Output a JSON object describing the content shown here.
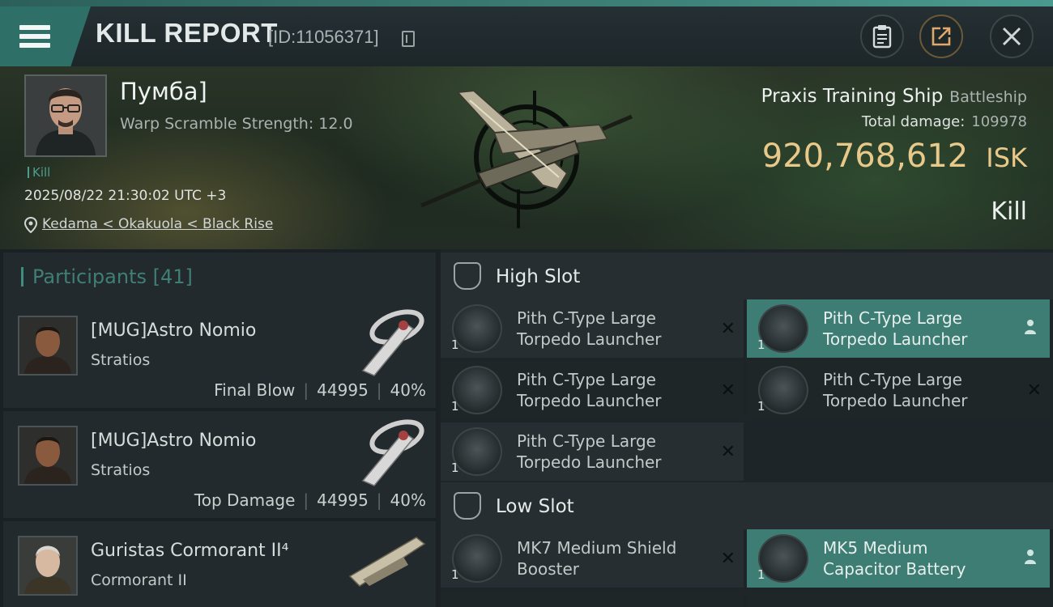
{
  "header": {
    "title": "KILL REPORT",
    "kill_id": "[ID:11056371]"
  },
  "victim": {
    "name": "Пумба]",
    "warp_scramble": "Warp Scramble Strength: 12.0",
    "tag": "Kill",
    "datetime": "2025/08/22 21:30:02 UTC +3",
    "location": "Kedama < Okakuola < Black Rise"
  },
  "ship": {
    "name": "Praxis Training Ship",
    "class": "Battleship",
    "total_damage_label": "Total damage:",
    "total_damage": "109978",
    "isk_value": "920,768,612",
    "isk_unit": "ISK",
    "result": "Kill"
  },
  "participants": {
    "label": "Participants",
    "count": "[41]",
    "items": [
      {
        "name": "[MUG]Astro Nomio",
        "ship": "Stratios",
        "tag": "Final Blow",
        "damage": "44995",
        "percent": "40%"
      },
      {
        "name": "[MUG]Astro Nomio",
        "ship": "Stratios",
        "tag": "Top Damage",
        "damage": "44995",
        "percent": "40%"
      },
      {
        "name": "Guristas Cormorant II⁴",
        "ship": "Cormorant II"
      }
    ]
  },
  "high_slot": {
    "label": "High Slot",
    "modules": [
      {
        "qty": "1",
        "line1": "Pith C-Type Large",
        "line2": "Torpedo Launcher",
        "status": "destroyed"
      },
      {
        "qty": "1",
        "line1": "Pith C-Type Large",
        "line2": "Torpedo Launcher",
        "status": "dropped"
      },
      {
        "qty": "1",
        "line1": "Pith C-Type Large",
        "line2": "Torpedo Launcher",
        "status": "destroyed"
      },
      {
        "qty": "1",
        "line1": "Pith C-Type Large",
        "line2": "Torpedo Launcher",
        "status": "destroyed"
      },
      {
        "qty": "1",
        "line1": "Pith C-Type Large",
        "line2": "Torpedo Launcher",
        "status": "destroyed"
      }
    ]
  },
  "low_slot": {
    "label": "Low Slot",
    "modules": [
      {
        "qty": "1",
        "line1": "MK7 Medium Shield",
        "line2": "Booster",
        "status": "destroyed"
      },
      {
        "qty": "1",
        "line1": "MK5 Medium",
        "line2": "Capacitor Battery",
        "status": "dropped"
      }
    ]
  },
  "icons": {
    "close": "×",
    "destroyed": "✕"
  },
  "colors": {
    "accent": "#3d7d74",
    "isk": "#e8c98a",
    "background": "#1b2124"
  }
}
